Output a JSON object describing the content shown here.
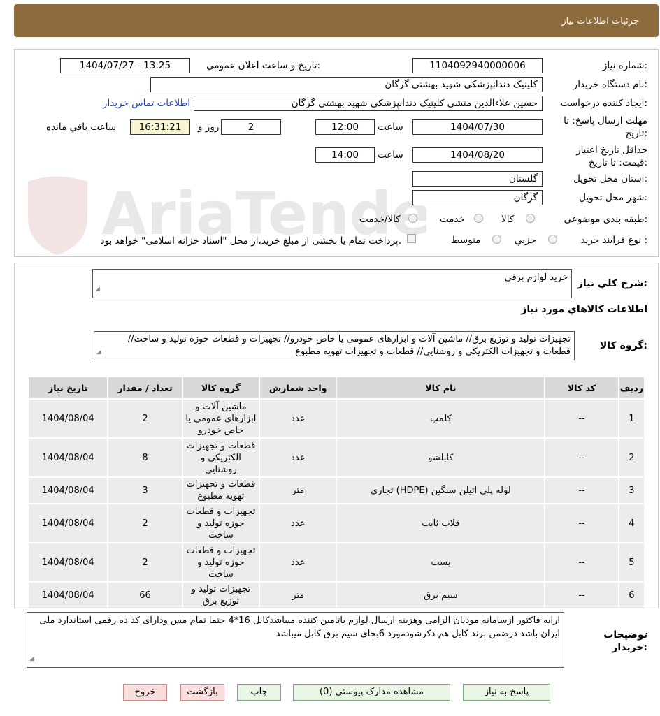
{
  "header": {
    "title": "جزئیات اطلاعات نیاز"
  },
  "fields": {
    "need_number_label": "شماره نیاز:",
    "need_number": "1104092940000006",
    "announce_label": "تاریخ و ساعت اعلان عمومي:",
    "announce_value": "1404/07/27 - 13:25",
    "buyer_org_label": "نام دستگاه خريدار:",
    "buyer_org": "کلینیک دندانپزشکی شهید بهشتی گرگان",
    "requester_label": "ايجاد کننده درخواست:",
    "requester": "حسین علاءالدین منشی کلینیک دندانپزشکی شهید بهشتی گرگان",
    "contact_link": "اطلاعات تماس خريدار",
    "deadline_label": "مهلت ارسال پاسخ: تا تاريخ:",
    "deadline_date": "1404/07/30",
    "time_label": "ساعت",
    "deadline_time": "12:00",
    "days_value": "2",
    "days_label": "روز و",
    "remaining_time": "16:31:21",
    "remaining_label": "ساعت باقي مانده",
    "validity_label": "حداقل تاريخ اعتبار قيمت: تا تاريخ:",
    "validity_date": "1404/08/20",
    "validity_time": "14:00",
    "province_label": "استان محل تحويل:",
    "province": "گلستان",
    "city_label": "شهر محل تحويل:",
    "city": "گرگان",
    "category_label": "طبقه بندی موضوعی:",
    "category_options": [
      "کالا",
      "خدمت",
      "کالا/خدمت"
    ],
    "process_label": "نوع فرآيند خريد :",
    "process_options": [
      "جزيي",
      "متوسط"
    ],
    "payment_note": "پرداخت تمام يا بخشی از مبلغ خريد،از محل \"اسناد خزانه اسلامی\" خواهد بود."
  },
  "summary": {
    "label": "شرح کلي نياز:",
    "value": "خرید لوازم برقی",
    "items_title": "اطلاعات کالاهاي مورد نياز",
    "group_label": "گروه کالا:",
    "group_value": "تجهیزات تولید و توزیع برق//  ماشین آلات و ابزارهای عمومی یا خاص خودرو// تجهیزات و قطعات حوزه تولید و ساخت// قطعات و تجهیزات الکتریکی و روشنایی//  قطعات و تجهیزات تهویه مطبوع"
  },
  "table": {
    "headers": [
      "ردیف",
      "کد کالا",
      "نام کالا",
      "واحد شمارش",
      "گروه کالا",
      "تعداد / مقدار",
      "تاریخ نیاز"
    ],
    "rows": [
      [
        "1",
        "--",
        "کلمپ",
        "عدد",
        "ماشین آلات و ابزارهای عمومی یا خاص خودرو",
        "2",
        "1404/08/04"
      ],
      [
        "2",
        "--",
        "کابلشو",
        "عدد",
        "قطعات و تجهیزات الکتریکی و روشنایی",
        "8",
        "1404/08/04"
      ],
      [
        "3",
        "--",
        "لوله پلی اتیلن سنگین (HDPE) تجاری",
        "متر",
        "قطعات و تجهیزات تهویه مطبوع",
        "3",
        "1404/08/04"
      ],
      [
        "4",
        "--",
        "قلاب ثابت",
        "عدد",
        "تجهیزات و قطعات حوزه تولید و ساخت",
        "2",
        "1404/08/04"
      ],
      [
        "5",
        "--",
        "بست",
        "عدد",
        "تجهیزات و قطعات حوزه تولید و ساخت",
        "2",
        "1404/08/04"
      ],
      [
        "6",
        "--",
        "سیم برق",
        "متر",
        "تجهیزات تولید و توزیع برق",
        "66",
        "1404/08/04"
      ]
    ]
  },
  "notes": {
    "label": "توضيحات خريدار:",
    "value": "ارایه فاکتور ازسامانه مودیان  الزامی وهزینه ارسال لوازم باتامین کننده میباشدکابل 16*4 حتما تمام مس ودارای کد ده رقمی استاندارد ملی ایران باشد درضمن برند کابل هم ذکرشودمورد 6بجای سیم برق کابل میباشد"
  },
  "buttons": {
    "reply": "پاسخ به نياز",
    "attachments": "مشاهده مدارک پيوستي (0)",
    "print": "چاپ",
    "back": "بازگشت",
    "exit": "خروج"
  },
  "watermark": {
    "text": "AriaTender.neT"
  }
}
